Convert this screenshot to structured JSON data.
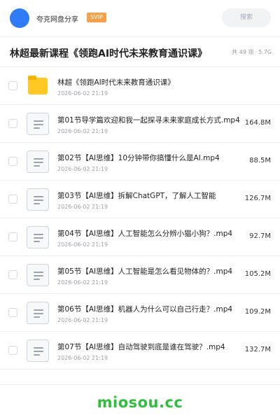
{
  "topbar": {
    "username": "夸克网盘分享",
    "badge": "SVIP",
    "search_placeholder": "搜索",
    "avatar_color": "#2f7cf6"
  },
  "header": {
    "title": "林超最新课程《领跑AI时代未来教育通识课》",
    "count": "共 49 项",
    "separator": "·",
    "total_size": "5.7G"
  },
  "files": [
    {
      "type": "folder",
      "name": "林超《领跑AI时代未来教育通识课》",
      "date": "2026-06-02 21:19",
      "size": ""
    },
    {
      "type": "file",
      "name": "第01节导学篇欢迎和我一起探寻未来家庭成长方式.mp4",
      "date": "2026-06-02 21:19",
      "size": "164.8M"
    },
    {
      "type": "file",
      "name": "第02节【AI思维】10分钟带你搞懂什么是AI.mp4",
      "date": "2026-06-02 21:19",
      "size": "88.5M"
    },
    {
      "type": "file",
      "name": "第03节【AI思维】拆解ChatGPT，了解人工智能",
      "date": "2026-06-02 21:19",
      "size": "126.7M"
    },
    {
      "type": "file",
      "name": "第04节【AI思维】人工智能怎么分辨小猫小狗？.mp4",
      "date": "2026-06-02 21:19",
      "size": "92.7M"
    },
    {
      "type": "file",
      "name": "第05节【AI思维】人工智能是怎么看见物体的？.mp4",
      "date": "2026-06-02 21:19",
      "size": "105.2M"
    },
    {
      "type": "file",
      "name": "第06节【AI思维】机器人为什么可以自己行走？.mp4",
      "date": "2026-06-02 21:19",
      "size": "109.2M"
    },
    {
      "type": "file",
      "name": "第07节【AI思维】自动驾驶到底是谁在驾驶？.mp4",
      "date": "2026-06-02 21:19",
      "size": "132.7M"
    }
  ],
  "watermark": "miosou.cc",
  "colors": {
    "folder": "#ffc824",
    "badge": "#f5a04a",
    "watermark": "#2fbf3d"
  }
}
